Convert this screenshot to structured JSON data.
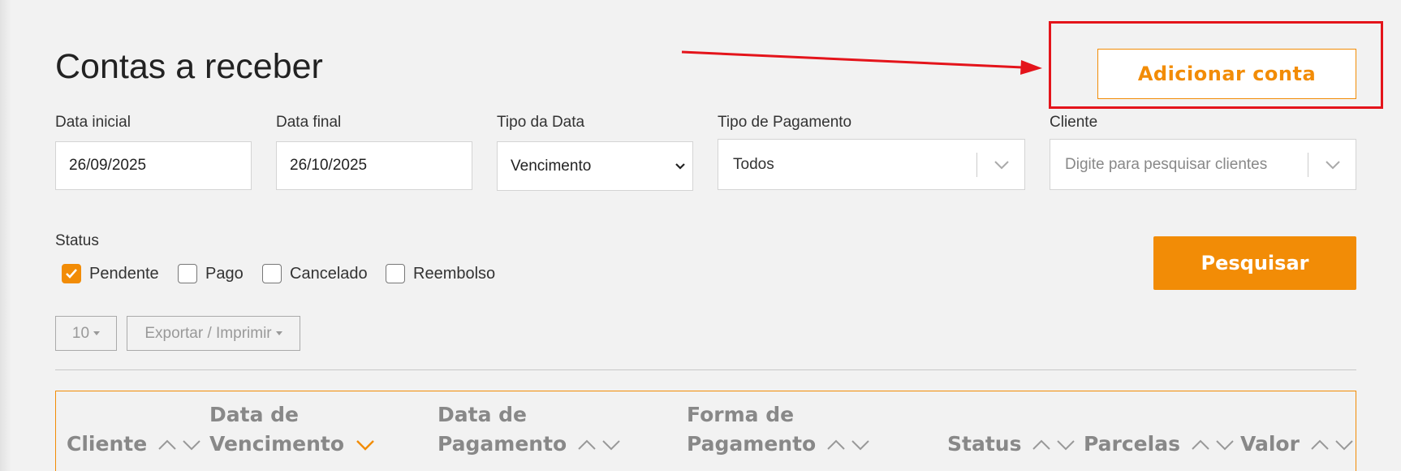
{
  "page": {
    "title": "Contas a receber",
    "add_button_label": "Adicionar conta"
  },
  "filters": {
    "data_inicial": {
      "label": "Data inicial",
      "value": "26/09/2025"
    },
    "data_final": {
      "label": "Data final",
      "value": "26/10/2025"
    },
    "tipo_data": {
      "label": "Tipo da Data",
      "value": "Vencimento"
    },
    "tipo_pagamento": {
      "label": "Tipo de Pagamento",
      "value": "Todos"
    },
    "cliente": {
      "label": "Cliente",
      "placeholder": "Digite para pesquisar clientes"
    }
  },
  "status": {
    "label": "Status",
    "options": [
      {
        "label": "Pendente",
        "checked": true
      },
      {
        "label": "Pago",
        "checked": false
      },
      {
        "label": "Cancelado",
        "checked": false
      },
      {
        "label": "Reembolso",
        "checked": false
      }
    ]
  },
  "search_button_label": "Pesquisar",
  "toolbar": {
    "page_size": "10",
    "export_label": "Exportar / Imprimir"
  },
  "table": {
    "headers": [
      {
        "line1": "",
        "line2": "Cliente"
      },
      {
        "line1": "Data de",
        "line2": "Vencimento"
      },
      {
        "line1": "Data de",
        "line2": "Pagamento"
      },
      {
        "line1": "Forma de",
        "line2": "Pagamento"
      },
      {
        "line1": "",
        "line2": "Status"
      },
      {
        "line1": "",
        "line2": "Parcelas"
      },
      {
        "line1": "",
        "line2": "Valor"
      }
    ],
    "active_sort_column": "Vencimento"
  },
  "colors": {
    "accent": "#f28c06",
    "annotation": "#e4141b",
    "background": "#f2f2f2"
  }
}
